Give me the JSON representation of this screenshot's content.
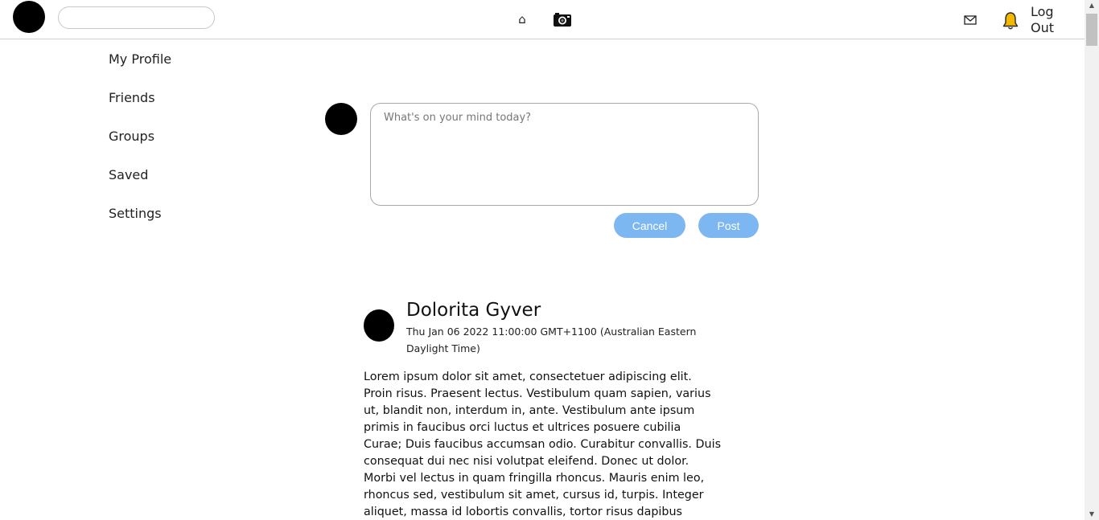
{
  "header": {
    "search_placeholder": "",
    "nav_home_icon": "home-icon",
    "nav_camera_icon": "camera-icon",
    "mail_icon": "mail-icon",
    "bell_icon": "bell-icon",
    "logout_label": "Log Out",
    "bell_color": "#f5b800"
  },
  "sidebar": {
    "items": [
      {
        "label": "My Profile"
      },
      {
        "label": "Friends"
      },
      {
        "label": "Groups"
      },
      {
        "label": "Saved"
      },
      {
        "label": "Settings"
      }
    ]
  },
  "composer": {
    "placeholder": "What's on your mind today?",
    "cancel_label": "Cancel",
    "post_label": "Post",
    "button_color": "#7db7f2"
  },
  "post": {
    "author": "Dolorita Gyver",
    "date": "Thu Jan 06 2022 11:00:00 GMT+1100 (Australian Eastern Daylight Time)",
    "body": "Lorem ipsum dolor sit amet, consectetuer adipiscing elit. Proin risus. Praesent lectus. Vestibulum quam sapien, varius ut, blandit non, interdum in, ante. Vestibulum ante ipsum primis in faucibus orci luctus et ultrices posuere cubilia Curae; Duis faucibus accumsan odio. Curabitur convallis. Duis consequat dui nec nisi volutpat eleifend. Donec ut dolor. Morbi vel lectus in quam fringilla rhoncus. Mauris enim leo, rhoncus sed, vestibulum sit amet, cursus id, turpis. Integer aliquet, massa id lobortis convallis, tortor risus dapibus augue, vel accumsan"
  }
}
